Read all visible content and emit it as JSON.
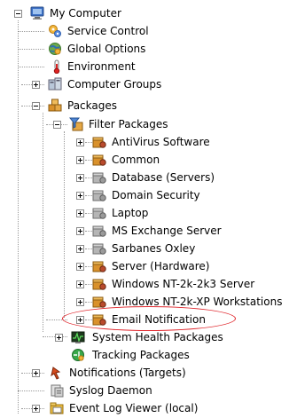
{
  "tree": {
    "root": {
      "label": "My Computer",
      "icon": "computer-icon"
    },
    "children": [
      {
        "label": "Service Control",
        "icon": "service-control-icon"
      },
      {
        "label": "Global Options",
        "icon": "global-options-icon"
      },
      {
        "label": "Environment",
        "icon": "thermometer-icon"
      },
      {
        "label": "Computer Groups",
        "icon": "computer-groups-icon"
      },
      {
        "label": "Packages",
        "icon": "packages-icon"
      }
    ],
    "filter_packages": {
      "label": "Filter Packages",
      "icon": "filter-icon"
    },
    "package_items": [
      {
        "label": "AntiVirus Software",
        "icon": "package-icon"
      },
      {
        "label": "Common",
        "icon": "package-icon"
      },
      {
        "label": "Database (Servers)",
        "icon": "package-gray-icon"
      },
      {
        "label": "Domain Security",
        "icon": "package-gray-icon"
      },
      {
        "label": "Laptop",
        "icon": "package-gray-icon"
      },
      {
        "label": "MS Exchange Server",
        "icon": "package-gray-icon"
      },
      {
        "label": "Sarbanes Oxley",
        "icon": "package-gray-icon"
      },
      {
        "label": "Server (Hardware)",
        "icon": "package-icon"
      },
      {
        "label": "Windows NT-2k-2k3 Server",
        "icon": "package-icon"
      },
      {
        "label": "Windows NT-2k-XP Workstations",
        "icon": "package-icon"
      },
      {
        "label": "Email Notification",
        "icon": "package-icon"
      }
    ],
    "packages_siblings": [
      {
        "label": "System Health Packages",
        "icon": "system-health-icon"
      },
      {
        "label": "Tracking Packages",
        "icon": "tracking-icon"
      }
    ],
    "bottom": [
      {
        "label": "Notifications (Targets)",
        "icon": "notifications-icon"
      },
      {
        "label": "Syslog Daemon",
        "icon": "syslog-icon"
      },
      {
        "label": "Event Log Viewer (local)",
        "icon": "event-log-icon"
      }
    ]
  },
  "colors": {
    "highlight": "#e0262c",
    "tree_line": "#9a9a9a"
  }
}
